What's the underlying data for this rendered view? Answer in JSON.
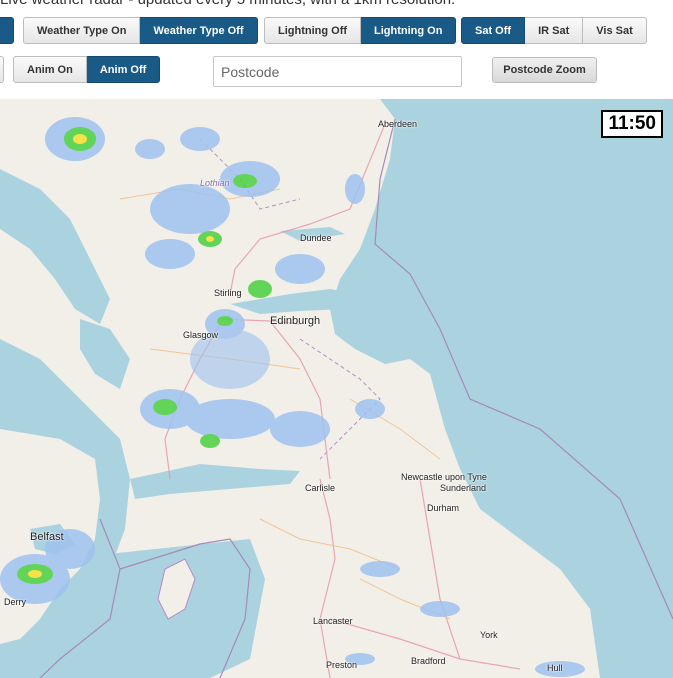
{
  "intro_text": "Live weather radar - updated every 5 minutes, with a 1km resolution.",
  "controls": {
    "weather_type": {
      "on_label": "Weather Type On",
      "off_label": "Weather Type Off",
      "selected": "off"
    },
    "lightning": {
      "off_label": "Lightning Off",
      "on_label": "Lightning On",
      "selected": "on"
    },
    "satellite": {
      "off_label": "Sat Off",
      "ir_label": "IR Sat",
      "vis_label": "Vis Sat",
      "selected": "off"
    },
    "animation": {
      "on_label": "Anim On",
      "off_label": "Anim Off",
      "selected": "off"
    },
    "postcode": {
      "placeholder": "Postcode",
      "value": ""
    },
    "postcode_zoom_label": "Postcode Zoom"
  },
  "map": {
    "timestamp": "11:50",
    "colors": {
      "sea": "#aad3df",
      "land": "#f2efe9",
      "active_button": "#1a5a86"
    },
    "places": [
      "Aberdeen",
      "Dundee",
      "Stirling",
      "Edinburgh",
      "Glasgow",
      "Newcastle upon Tyne",
      "Sunderland",
      "Durham",
      "Carlisle",
      "Lancaster",
      "York",
      "Preston",
      "Bradford",
      "Hull",
      "Belfast",
      "Lothian",
      "Derry"
    ]
  }
}
